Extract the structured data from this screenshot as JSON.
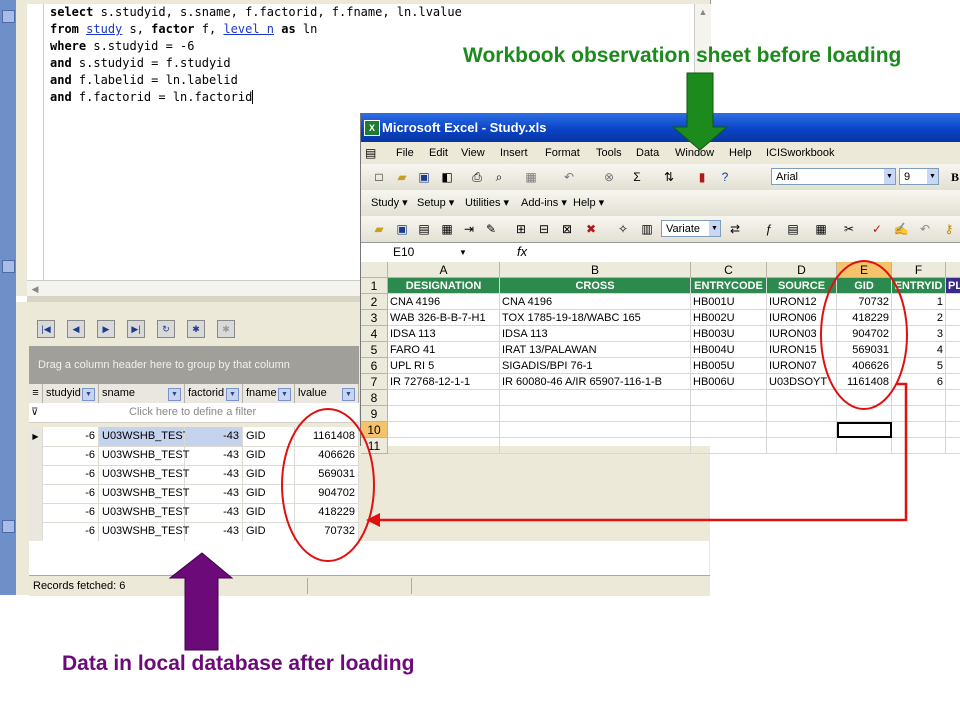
{
  "sql": {
    "lines": [
      [
        {
          "t": "select",
          "k": 1
        },
        {
          "t": " s.studyid, s.sname, f.factorid, f.fname, ln.lvalue"
        }
      ],
      [
        {
          "t": "from",
          "k": 1
        },
        {
          "t": " "
        },
        {
          "t": "study",
          "u": 1
        },
        {
          "t": " s, "
        },
        {
          "t": "factor",
          "k": 1
        },
        {
          "t": " f, "
        },
        {
          "t": "level n",
          "u": 1
        },
        {
          "t": " "
        },
        {
          "t": "as",
          "k": 1
        },
        {
          "t": " ln"
        }
      ],
      [
        {
          "t": "where",
          "k": 1
        },
        {
          "t": " s.studyid = -6"
        }
      ],
      [
        {
          "t": "and",
          "k": 1
        },
        {
          "t": " s.studyid = f.studyid"
        }
      ],
      [
        {
          "t": "and",
          "k": 1
        },
        {
          "t": " f.labelid = ln.labelid"
        }
      ],
      [
        {
          "t": "and",
          "k": 1
        },
        {
          "t": " f.factorid = ln.factorid"
        }
      ]
    ]
  },
  "grid": {
    "group_hint": "Drag a column header here to group by that column",
    "filter_hint": "Click here to define a filter",
    "columns": [
      "studyid",
      "sname",
      "factorid",
      "fname",
      "lvalue"
    ],
    "rows": [
      [
        "-6",
        "U03WSHB_TEST",
        "-43",
        "GID",
        "1161408"
      ],
      [
        "-6",
        "U03WSHB_TEST",
        "-43",
        "GID",
        "406626"
      ],
      [
        "-6",
        "U03WSHB_TEST",
        "-43",
        "GID",
        "569031"
      ],
      [
        "-6",
        "U03WSHB_TEST",
        "-43",
        "GID",
        "904702"
      ],
      [
        "-6",
        "U03WSHB_TEST",
        "-43",
        "GID",
        "418229"
      ],
      [
        "-6",
        "U03WSHB_TEST",
        "-43",
        "GID",
        "70732"
      ]
    ],
    "status": "Records fetched: 6"
  },
  "excel": {
    "title": "Microsoft Excel - Study.xls",
    "menu": [
      "File",
      "Edit",
      "View",
      "Insert",
      "Format",
      "Tools",
      "Data",
      "Window",
      "Help",
      "ICISworkbook"
    ],
    "font_name": "Arial",
    "font_size": "9",
    "bold_label": "B",
    "addin_menu": [
      "Study ▾",
      "Setup ▾",
      "Utilities ▾",
      "Add-ins ▾",
      "Help ▾"
    ],
    "variate_label": "Variate",
    "name_box": "E10",
    "fx_label": "fx",
    "col_letters": [
      "A",
      "B",
      "C",
      "D",
      "E",
      "F"
    ],
    "row_numbers": [
      "1",
      "2",
      "3",
      "4",
      "5",
      "6",
      "7",
      "8",
      "9",
      "10",
      "11"
    ],
    "headers": [
      "DESIGNATION",
      "CROSS",
      "ENTRYCODE",
      "SOURCE",
      "GID",
      "ENTRYID",
      "PL"
    ],
    "rows": [
      [
        "CNA 4196",
        "CNA 4196",
        "HB001U",
        "IURON12",
        "70732",
        "1"
      ],
      [
        "WAB 326-B-B-7-H1",
        "TOX 1785-19-18/WABC 165",
        "HB002U",
        "IURON06",
        "418229",
        "2"
      ],
      [
        "IDSA 113",
        "IDSA 113",
        "HB003U",
        "IURON03",
        "904702",
        "3"
      ],
      [
        "FARO 41",
        "IRAT 13/PALAWAN",
        "HB004U",
        "IURON15",
        "569031",
        "4"
      ],
      [
        "UPL RI 5",
        "SIGADIS/BPI 76-1",
        "HB005U",
        "IURON07",
        "406626",
        "5"
      ],
      [
        "IR 72768-12-1-1",
        "IR 60080-46 A/IR 65907-116-1-B",
        "HB006U",
        "U03DSOYT",
        "1161408",
        "6"
      ]
    ]
  },
  "annotations": {
    "top": "Workbook observation sheet before loading",
    "bottom": "Data in local database after loading"
  },
  "colors": {
    "annotation_top": "#1c8a1c",
    "annotation_bottom": "#6b0a78",
    "excel_header": "#2d8a4e",
    "circle": "#e01010"
  }
}
